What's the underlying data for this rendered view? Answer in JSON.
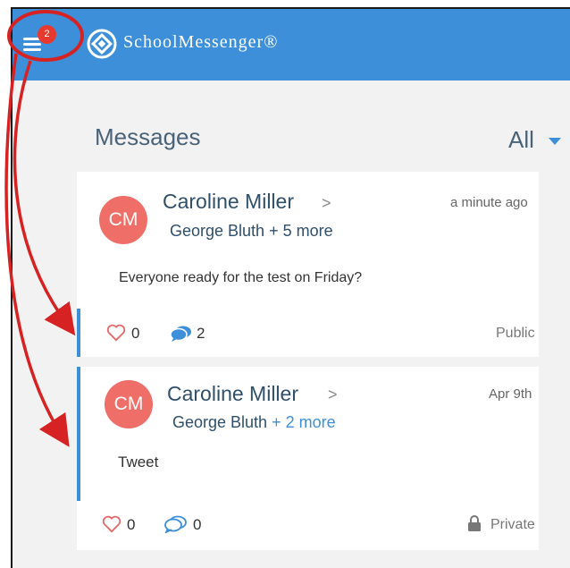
{
  "header": {
    "menu_badge": "2",
    "brand": "SchoolMessenger®"
  },
  "main": {
    "title": "Messages",
    "filter_label": "All"
  },
  "messages": [
    {
      "avatar_initials": "CM",
      "sender": "Caroline Miller",
      "chevron": ">",
      "time": "a minute ago",
      "recipient": "George Bluth",
      "more": "+ 5 more",
      "body": "Everyone ready for the test on Friday?",
      "likes": "0",
      "comments": "2",
      "visibility": "Public"
    },
    {
      "avatar_initials": "CM",
      "sender": "Caroline Miller",
      "chevron": ">",
      "time": "Apr 9th",
      "recipient": "George Bluth",
      "more": "+ 2 more",
      "body": "Tweet",
      "likes": "0",
      "comments": "0",
      "visibility": "Private"
    }
  ],
  "colors": {
    "topbar": "#3d8fd9",
    "badge": "#e8392f",
    "avatar": "#f06e68",
    "annotation": "#d62222"
  }
}
